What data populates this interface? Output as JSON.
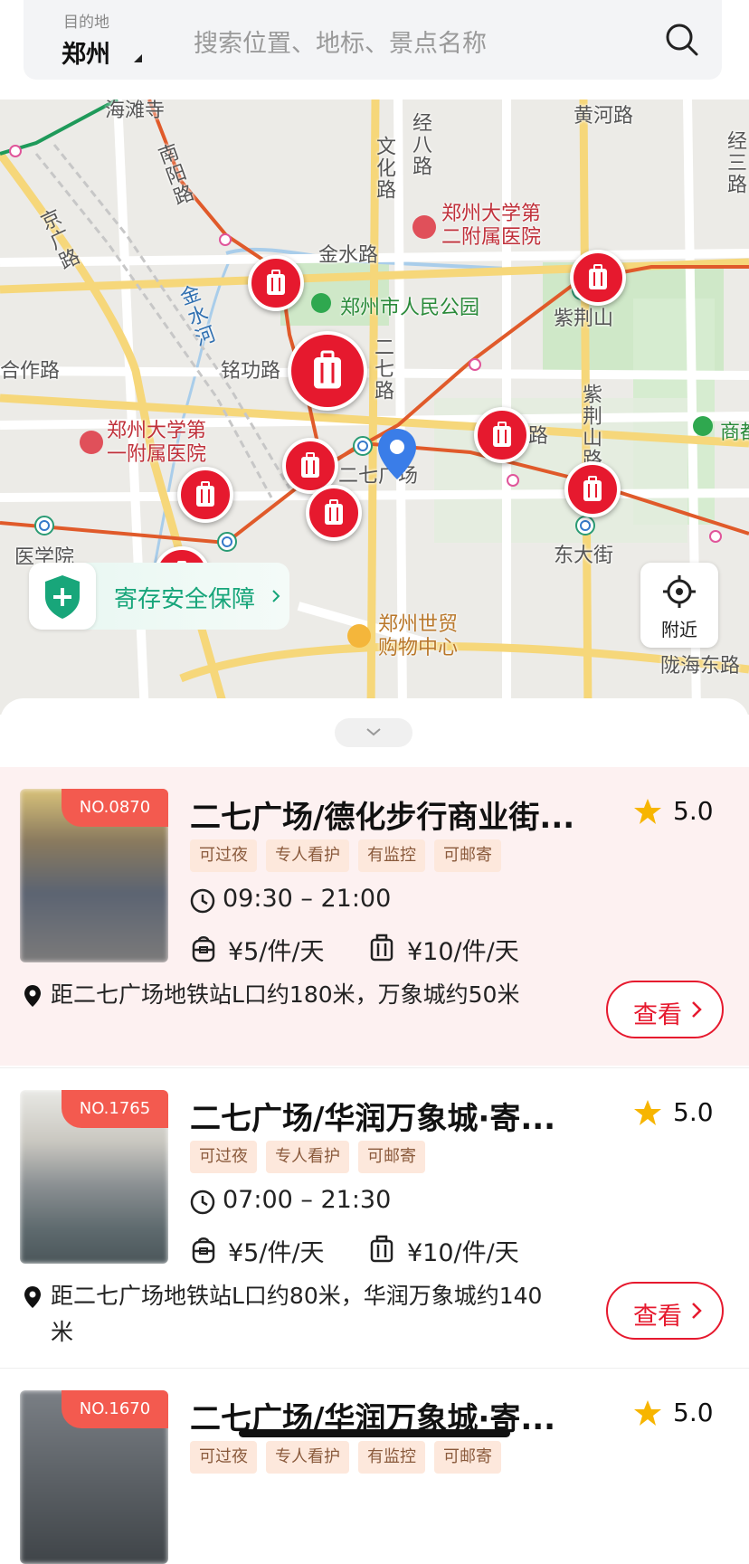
{
  "header": {
    "dest_label": "目的地",
    "city": "郑州",
    "search_placeholder": "搜索位置、地标、景点名称"
  },
  "map": {
    "labels": {
      "hainan_temple": "海滩寺",
      "huanghe_rd": "黄河路",
      "jing8_rd": "经八路",
      "wenhua_rd": "文化路",
      "nanyang_rd": "南阳路",
      "jing3_rd": "经三路",
      "hospital2": "郑州大学第二附属医院",
      "jinshui_rd": "金水路",
      "jing_guang_rd": "京广路",
      "jinshui_river": "金水河",
      "peoples_park": "郑州市人民公园",
      "zijingshan": "紫荆山",
      "hezuo_rd": "合作路",
      "minggong_rd": "铭功路",
      "erqi_rd": "二七路",
      "zijingshan_rd": "紫荆山路",
      "lu": "路",
      "shangcheng": "商都",
      "hospital1": "郑州大学第一附属医院",
      "erqi_square": "二七广场",
      "medical_college": "医学院",
      "dongdajie": "东大街",
      "world_trade": "郑州世贸购物中心",
      "longhai_rd": "陇海东路"
    },
    "safety_badge": "寄存安全保障",
    "nearby_label": "附近"
  },
  "listings": [
    {
      "no": "NO.0870",
      "title": "二七广场/德化步行商业街...",
      "rating": "5.0",
      "tags": [
        "可过夜",
        "专人看护",
        "有监控",
        "可邮寄"
      ],
      "hours": "09:30 – 21:00",
      "price_small": "¥5/件/天",
      "price_large": "¥10/件/天",
      "address": "距二七广场地铁站L口约180米，万象城约50米",
      "view_label": "查看"
    },
    {
      "no": "NO.1765",
      "title": "二七广场/华润万象城·寄...",
      "rating": "5.0",
      "tags": [
        "可过夜",
        "专人看护",
        "可邮寄"
      ],
      "hours": "07:00 – 21:30",
      "price_small": "¥5/件/天",
      "price_large": "¥10/件/天",
      "address": "距二七广场地铁站L口约80米，华润万象城约140米",
      "view_label": "查看"
    },
    {
      "no": "NO.1670",
      "title": "二七广场/华润万象城·寄...",
      "rating": "5.0",
      "tags": [
        "可过夜",
        "专人看护",
        "有监控",
        "可邮寄"
      ]
    }
  ],
  "colors": {
    "brand_red": "#e6192e",
    "tag_orange": "#f35a4f",
    "safety_green": "#17a57a"
  }
}
